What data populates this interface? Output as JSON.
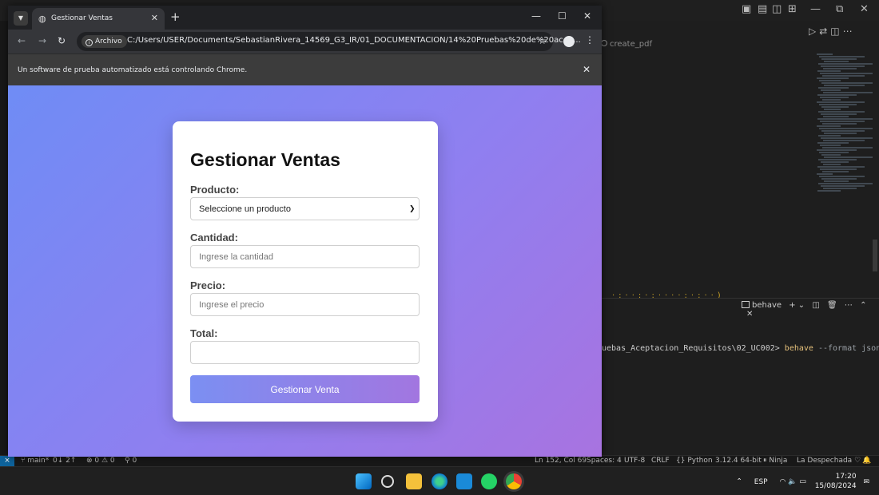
{
  "vscode": {
    "editor_tab": "create_pdf",
    "terminal": {
      "panel_name": "behave",
      "path_tail": "uebas_Aceptacion_Requisitos\\02_UC002>",
      "command": "behave",
      "args": "--format json --outf"
    },
    "status": {
      "branch": "main*",
      "sync": "0↓ 2↑",
      "problems": "⊗ 0 ⚠ 0",
      "ports": "⚲ 0",
      "cursor": "Ln 152, Col 69",
      "spaces": "Spaces: 4",
      "encoding": "UTF-8",
      "eol": "CRLF",
      "language": "Python",
      "interpreter": "3.12.4 64-bit",
      "ninja": "Ninja",
      "profile": "La Despechada"
    }
  },
  "chrome": {
    "tab_title": "Gestionar Ventas",
    "chip_label": "Archivo",
    "url": "C:/Users/USER/Documents/SebastianRivera_14569_G3_IR/01_DOCUMENTACION/14%20Pruebas%20de%20acep...",
    "infobar_text": "Un software de prueba automatizado está controlando Chrome."
  },
  "form": {
    "title": "Gestionar Ventas",
    "product_label": "Producto:",
    "product_selected": "Seleccione un producto",
    "quantity_label": "Cantidad:",
    "quantity_placeholder": "Ingrese la cantidad",
    "price_label": "Precio:",
    "price_placeholder": "Ingrese el precio",
    "total_label": "Total:",
    "total_value": "",
    "submit_label": "Gestionar Venta"
  },
  "taskbar": {
    "language": "ESP",
    "time": "17:20",
    "date": "15/08/2024"
  }
}
